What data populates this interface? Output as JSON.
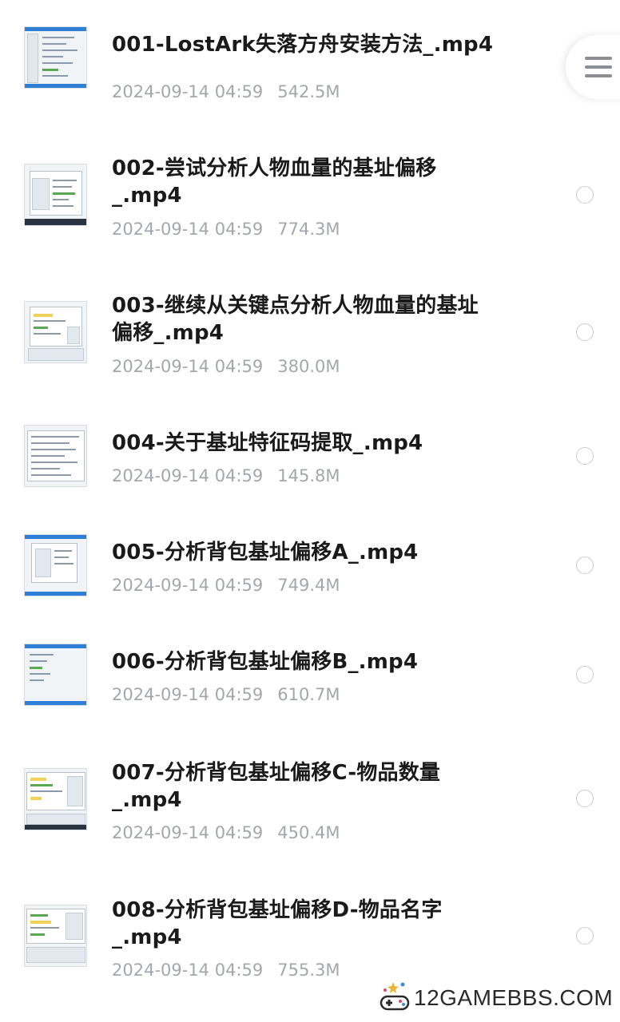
{
  "files": [
    {
      "name": "001-LostArk失落方舟安装方法_.mp4",
      "date": "2024-09-14 04:59",
      "size": "542.5M"
    },
    {
      "name": "002-尝试分析人物血量的基址偏移_.mp4",
      "date": "2024-09-14 04:59",
      "size": "774.3M"
    },
    {
      "name": "003-继续从关键点分析人物血量的基址偏移_.mp4",
      "date": "2024-09-14 04:59",
      "size": "380.0M"
    },
    {
      "name": "004-关于基址特征码提取_.mp4",
      "date": "2024-09-14 04:59",
      "size": "145.8M"
    },
    {
      "name": "005-分析背包基址偏移A_.mp4",
      "date": "2024-09-14 04:59",
      "size": "749.4M"
    },
    {
      "name": "006-分析背包基址偏移B_.mp4",
      "date": "2024-09-14 04:59",
      "size": "610.7M"
    },
    {
      "name": "007-分析背包基址偏移C-物品数量_.mp4",
      "date": "2024-09-14 04:59",
      "size": "450.4M"
    },
    {
      "name": "008-分析背包基址偏移D-物品名字_.mp4",
      "date": "2024-09-14 04:59",
      "size": "755.3M"
    }
  ],
  "title_lines": [
    [
      "001-LostArk失落方舟安装方法_.mp4"
    ],
    [
      "002-尝试分析人物血量的基址偏移",
      "_.mp4"
    ],
    [
      "003-继续从关键点分析人物血量的基址",
      "偏移_.mp4"
    ],
    [
      "004-关于基址特征码提取_.mp4"
    ],
    [
      "005-分析背包基址偏移A_.mp4"
    ],
    [
      "006-分析背包基址偏移B_.mp4"
    ],
    [
      "007-分析背包基址偏移C-物品数量",
      "_.mp4"
    ],
    [
      "008-分析背包基址偏移D-物品名字",
      "_.mp4"
    ]
  ],
  "icons": {
    "menu": "hamburger-menu-icon",
    "select": "radio-circle-icon",
    "watermark_logo": "game-controller-icon"
  },
  "watermark": {
    "text": "12GAMEBBS.COM"
  },
  "colors": {
    "title": "#1a1a1a",
    "meta": "#a3a7ad",
    "radio_border": "#c9ccd0",
    "menu_lines": "#8a8f96"
  }
}
